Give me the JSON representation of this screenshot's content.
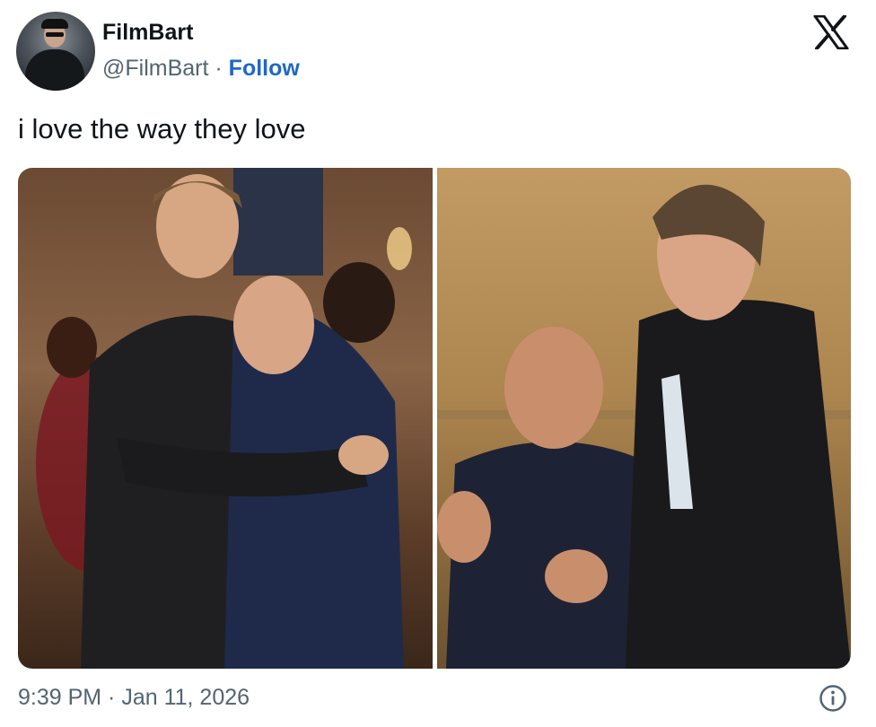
{
  "author": {
    "display_name": "FilmBart",
    "handle": "@FilmBart",
    "separator": "·",
    "follow_label": "Follow"
  },
  "tweet": {
    "text": "i love the way they love"
  },
  "media": {
    "count": 2,
    "items": [
      {
        "kind": "photo",
        "subject": "two men hugging and smiling at an event"
      },
      {
        "kind": "photo",
        "subject": "two men laughing face to face"
      }
    ]
  },
  "footer": {
    "timestamp": "9:39 PM · Jan 11, 2026"
  },
  "colors": {
    "text_primary": "#0f1419",
    "text_secondary": "#536471",
    "follow_link": "#1d68c7",
    "background": "#ffffff"
  },
  "icons": {
    "brand": "x-logo-icon",
    "info": "info-icon"
  }
}
